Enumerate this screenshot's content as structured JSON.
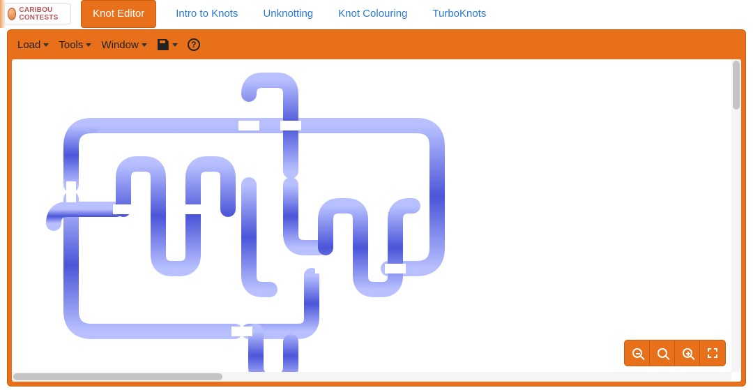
{
  "logo_text": "CARIBOU CONTESTS",
  "nav": [
    {
      "label": "Knot Editor",
      "active": true
    },
    {
      "label": "Intro to Knots",
      "active": false
    },
    {
      "label": "Unknotting",
      "active": false
    },
    {
      "label": "Knot Colouring",
      "active": false
    },
    {
      "label": "TurboKnots",
      "active": false
    }
  ],
  "toolbar": {
    "load": "Load",
    "tools": "Tools",
    "window": "Window",
    "save_icon": "save-icon",
    "help_icon": "help-icon",
    "help_glyph": "?"
  },
  "zoom": {
    "out": "zoom-out",
    "reset": "zoom-reset",
    "in": "zoom-in",
    "full": "fullscreen"
  },
  "knot": {
    "stroke": "#4b55d8",
    "highlight": "#8c96ff",
    "width": 22
  }
}
